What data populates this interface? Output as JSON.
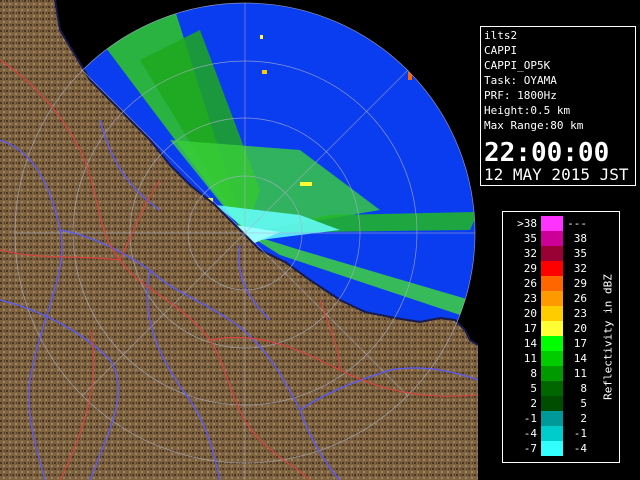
{
  "info": {
    "station": "ilts2",
    "product": "CAPPI",
    "product_id": "CAPPI_OP5K",
    "task": "Task: OYAMA",
    "prf": "PRF: 1800Hz",
    "height": "Height:0.5 km",
    "max_range": "Max Range:80 km",
    "time": "22:00:00",
    "date": "12 MAY 2015 JST"
  },
  "legend": {
    "unit_label": "Reflectivity in dBZ",
    "rows": [
      {
        "lo": ">38",
        "hi": "---",
        "color": "#ff33ff"
      },
      {
        "lo": "35",
        "hi": "38",
        "color": "#cc0099"
      },
      {
        "lo": "32",
        "hi": "35",
        "color": "#990033"
      },
      {
        "lo": "29",
        "hi": "32",
        "color": "#ff0000"
      },
      {
        "lo": "26",
        "hi": "29",
        "color": "#ff6600"
      },
      {
        "lo": "23",
        "hi": "26",
        "color": "#ff9900"
      },
      {
        "lo": "20",
        "hi": "23",
        "color": "#ffcc00"
      },
      {
        "lo": "17",
        "hi": "20",
        "color": "#ffff33"
      },
      {
        "lo": "14",
        "hi": "17",
        "color": "#00ff00"
      },
      {
        "lo": "11",
        "hi": "14",
        "color": "#00cc00"
      },
      {
        "lo": "8",
        "hi": "11",
        "color": "#009900"
      },
      {
        "lo": "5",
        "hi": "8",
        "color": "#006600"
      },
      {
        "lo": "2",
        "hi": "5",
        "color": "#004d00"
      },
      {
        "lo": "-1",
        "hi": "2",
        "color": "#009999"
      },
      {
        "lo": "-4",
        "hi": "-1",
        "color": "#00cccc"
      },
      {
        "lo": "-7",
        "hi": "-4",
        "color": "#33ffff"
      }
    ]
  },
  "colors": {
    "sea": "#0a3cf0",
    "land": "#7d6242",
    "coast": "#1a1a4a",
    "rivers": "#5a5aff",
    "borders": "#e04040",
    "range_rings": "#aab0c8"
  }
}
